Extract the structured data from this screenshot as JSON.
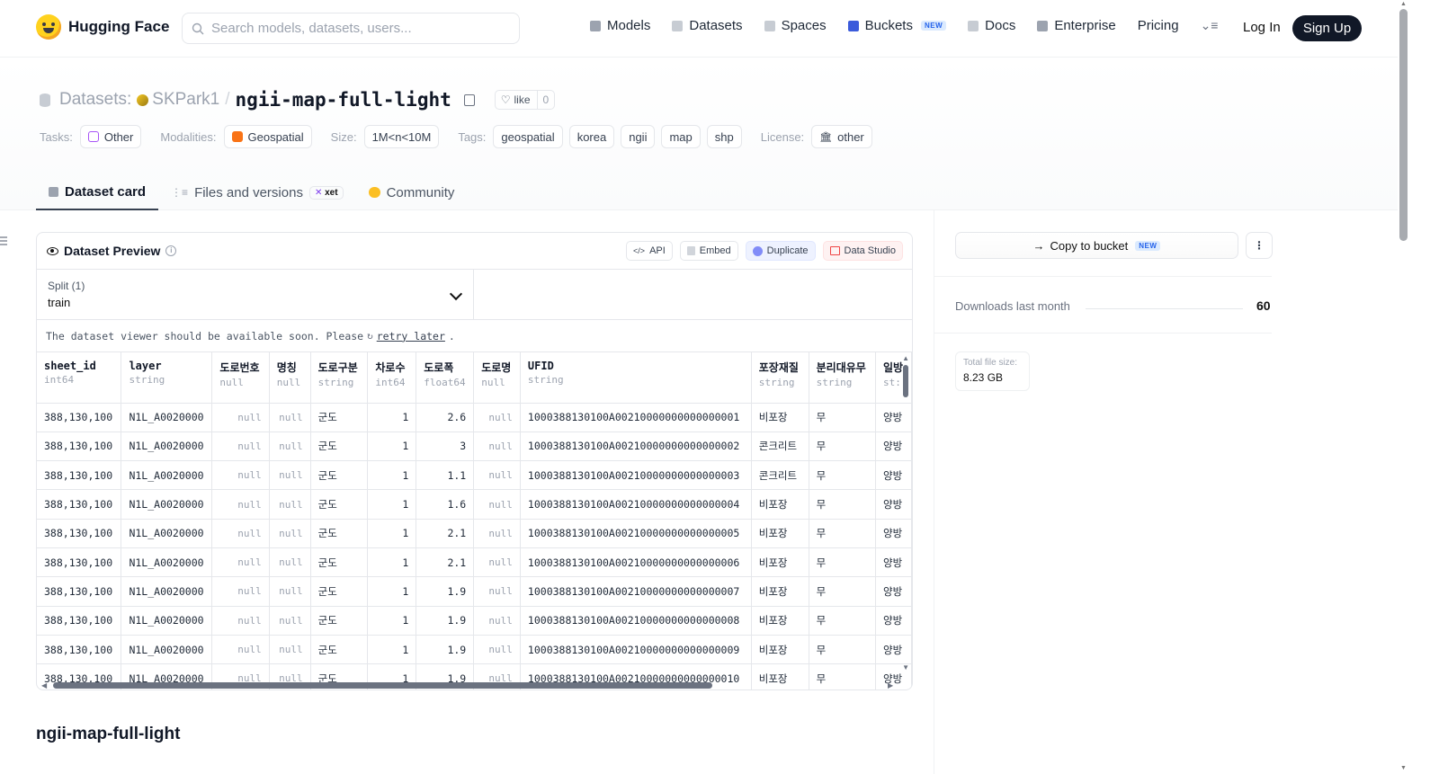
{
  "header": {
    "logo_text": "Hugging Face",
    "search_placeholder": "Search models, datasets, users...",
    "nav": [
      {
        "label": "Models",
        "color": "#9ca3af"
      },
      {
        "label": "Datasets",
        "color": "#c7ccd3"
      },
      {
        "label": "Spaces",
        "color": "#c7ccd3"
      },
      {
        "label": "Buckets",
        "color": "#3b5bdb",
        "badge": "NEW"
      },
      {
        "label": "Docs",
        "color": "#c7ccd3"
      },
      {
        "label": "Enterprise",
        "color": "#9ca3af"
      },
      {
        "label": "Pricing"
      }
    ],
    "login": "Log In",
    "signup": "Sign Up"
  },
  "repo": {
    "type_label": "Datasets:",
    "owner": "SKPark1",
    "separator": "/",
    "name": "ngii-map-full-light",
    "like_label": "like",
    "like_count": "0"
  },
  "tags": {
    "tasks_label": "Tasks:",
    "tasks": [
      "Other"
    ],
    "modalities_label": "Modalities:",
    "modalities": [
      "Geospatial"
    ],
    "size_label": "Size:",
    "size": [
      "1M<n<10M"
    ],
    "tags_label": "Tags:",
    "tags": [
      "geospatial",
      "korea",
      "ngii",
      "map",
      "shp"
    ],
    "license_label": "License:",
    "license": [
      "other"
    ]
  },
  "tabs": [
    {
      "label": "Dataset card",
      "active": true
    },
    {
      "label": "Files and versions",
      "badge": "xet"
    },
    {
      "label": "Community"
    }
  ],
  "preview": {
    "title": "Dataset Preview",
    "actions": [
      "API",
      "Embed",
      "Duplicate",
      "Data Studio"
    ],
    "split_label": "Split (1)",
    "split_value": "train",
    "notice_text": "The dataset viewer should be available soon. Please",
    "notice_link": "retry later",
    "notice_end": ".",
    "columns": [
      {
        "name": "sheet_id",
        "type": "int64"
      },
      {
        "name": "layer",
        "type": "string"
      },
      {
        "name": "도로번호",
        "type": "null"
      },
      {
        "name": "명칭",
        "type": "null"
      },
      {
        "name": "도로구분",
        "type": "string"
      },
      {
        "name": "차로수",
        "type": "int64"
      },
      {
        "name": "도로폭",
        "type": "float64"
      },
      {
        "name": "도로명",
        "type": "null"
      },
      {
        "name": "UFID",
        "type": "string"
      },
      {
        "name": "포장재질",
        "type": "string"
      },
      {
        "name": "분리대유무",
        "type": "string"
      },
      {
        "name": "일방",
        "type": "st:"
      }
    ],
    "rows": [
      [
        "388,130,100",
        "N1L_A0020000",
        "null",
        "null",
        "군도",
        "1",
        "2.6",
        "null",
        "1000388130100A00210000000000000001",
        "비포장",
        "무",
        "양방"
      ],
      [
        "388,130,100",
        "N1L_A0020000",
        "null",
        "null",
        "군도",
        "1",
        "3",
        "null",
        "1000388130100A00210000000000000002",
        "콘크리트",
        "무",
        "양방"
      ],
      [
        "388,130,100",
        "N1L_A0020000",
        "null",
        "null",
        "군도",
        "1",
        "1.1",
        "null",
        "1000388130100A00210000000000000003",
        "콘크리트",
        "무",
        "양방"
      ],
      [
        "388,130,100",
        "N1L_A0020000",
        "null",
        "null",
        "군도",
        "1",
        "1.6",
        "null",
        "1000388130100A00210000000000000004",
        "비포장",
        "무",
        "양방"
      ],
      [
        "388,130,100",
        "N1L_A0020000",
        "null",
        "null",
        "군도",
        "1",
        "2.1",
        "null",
        "1000388130100A00210000000000000005",
        "비포장",
        "무",
        "양방"
      ],
      [
        "388,130,100",
        "N1L_A0020000",
        "null",
        "null",
        "군도",
        "1",
        "2.1",
        "null",
        "1000388130100A00210000000000000006",
        "비포장",
        "무",
        "양방"
      ],
      [
        "388,130,100",
        "N1L_A0020000",
        "null",
        "null",
        "군도",
        "1",
        "1.9",
        "null",
        "1000388130100A00210000000000000007",
        "비포장",
        "무",
        "양방"
      ],
      [
        "388,130,100",
        "N1L_A0020000",
        "null",
        "null",
        "군도",
        "1",
        "1.9",
        "null",
        "1000388130100A00210000000000000008",
        "비포장",
        "무",
        "양방"
      ],
      [
        "388,130,100",
        "N1L_A0020000",
        "null",
        "null",
        "군도",
        "1",
        "1.9",
        "null",
        "1000388130100A00210000000000000009",
        "비포장",
        "무",
        "양방"
      ],
      [
        "388,130,100",
        "N1L_A0020000",
        "null",
        "null",
        "군도",
        "1",
        "1.9",
        "null",
        "1000388130100A00210000000000000010",
        "비포장",
        "무",
        "양방"
      ]
    ]
  },
  "section_title": "ngii-map-full-light",
  "sidebar": {
    "bucket_label": "Copy to bucket",
    "bucket_badge": "NEW",
    "downloads_label": "Downloads last month",
    "downloads_value": "60",
    "size_label": "Total file size:",
    "size_value": "8.23 GB"
  }
}
